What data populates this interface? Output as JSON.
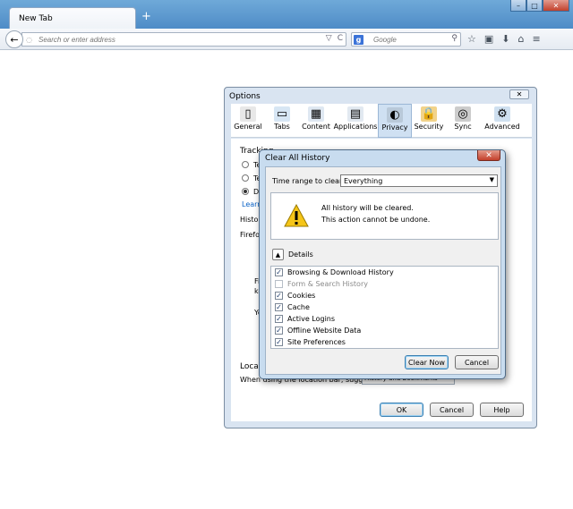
{
  "browser": {
    "tab_title": "New Tab",
    "new_tab_symbol": "+",
    "window_controls": [
      "–",
      "□",
      "✕"
    ],
    "back_symbol": "←",
    "url_placeholder": "Search or enter address",
    "url_icons": [
      "▽",
      "C"
    ],
    "search_engine_letter": "g",
    "search_placeholder": "Google",
    "search_icon_symbol": "⚲",
    "toolbar_icons": [
      "☆",
      "▣",
      "⬇",
      "⌂",
      "≡"
    ]
  },
  "options": {
    "title": "Options",
    "close_symbol": "✕",
    "tabs": [
      {
        "label": "General",
        "icon": "general-icon",
        "glyph": "▯",
        "color": "#e8e8e8"
      },
      {
        "label": "Tabs",
        "icon": "tabs-icon",
        "glyph": "▭",
        "color": "#d7e6f4"
      },
      {
        "label": "Content",
        "icon": "content-icon",
        "glyph": "▦",
        "color": "#dfe8f2"
      },
      {
        "label": "Applications",
        "icon": "applications-icon",
        "glyph": "▤",
        "color": "#e2e9f1"
      },
      {
        "label": "Privacy",
        "icon": "privacy-mask-icon",
        "glyph": "◐",
        "color": "#b9c9d9",
        "selected": true
      },
      {
        "label": "Security",
        "icon": "security-lock-icon",
        "glyph": "🔒",
        "color": "#f2d38a"
      },
      {
        "label": "Sync",
        "icon": "sync-icon",
        "glyph": "◎",
        "color": "#cccccc"
      },
      {
        "label": "Advanced",
        "icon": "advanced-gear-icon",
        "glyph": "⚙",
        "color": "#cfe0f0"
      }
    ],
    "tracking_fragment": "Tracking",
    "radio_fragments": [
      "Te",
      "Te",
      "D"
    ],
    "learn_fragment": "Learn",
    "history_fragment": "Histor",
    "firefox_fragment": "Firefo",
    "left_fragments": [
      "Fi",
      "ke",
      "Yo"
    ],
    "location_bar_fragment": "Locatio",
    "location_row_text": "When using the location bar, suggest:",
    "location_select_value": "History and Bookmarks",
    "buttons": {
      "ok": "OK",
      "cancel": "Cancel",
      "help": "Help"
    }
  },
  "clear_history": {
    "title": "Clear All History",
    "close_symbol": "✕",
    "time_range_label": "Time range to clear:",
    "time_range_value": "Everything",
    "dropdown_arrow": "▼",
    "warning_line1": "All history will be cleared.",
    "warning_line2": "This action cannot be undone.",
    "details_toggle_symbol": "▲",
    "details_label": "Details",
    "items": [
      {
        "label": "Browsing & Download History",
        "checked": true
      },
      {
        "label": "Form & Search History",
        "checked": false
      },
      {
        "label": "Cookies",
        "checked": true
      },
      {
        "label": "Cache",
        "checked": true
      },
      {
        "label": "Active Logins",
        "checked": true
      },
      {
        "label": "Offline Website Data",
        "checked": true
      },
      {
        "label": "Site Preferences",
        "checked": true
      }
    ],
    "check_symbol": "✓",
    "clear_now_label": "Clear Now",
    "cancel_label": "Cancel"
  }
}
